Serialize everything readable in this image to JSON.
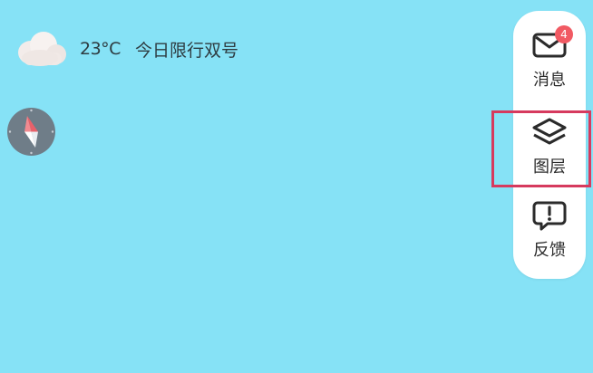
{
  "weather": {
    "icon": "cloud-icon",
    "temperature": "23°C",
    "restriction": "今日限行双号"
  },
  "compass": {
    "icon": "compass-icon"
  },
  "side_panel": {
    "items": [
      {
        "label": "消息",
        "icon": "envelope-icon",
        "badge": "4"
      },
      {
        "label": "图层",
        "icon": "layers-icon"
      },
      {
        "label": "反馈",
        "icon": "feedback-icon"
      }
    ]
  },
  "colors": {
    "map_background": "#86e2f6",
    "panel": "#ffffff",
    "badge": "#f15a63",
    "highlight": "#d63a5e",
    "compass_red": "#e8616a",
    "compass_body": "#6f7d88"
  }
}
